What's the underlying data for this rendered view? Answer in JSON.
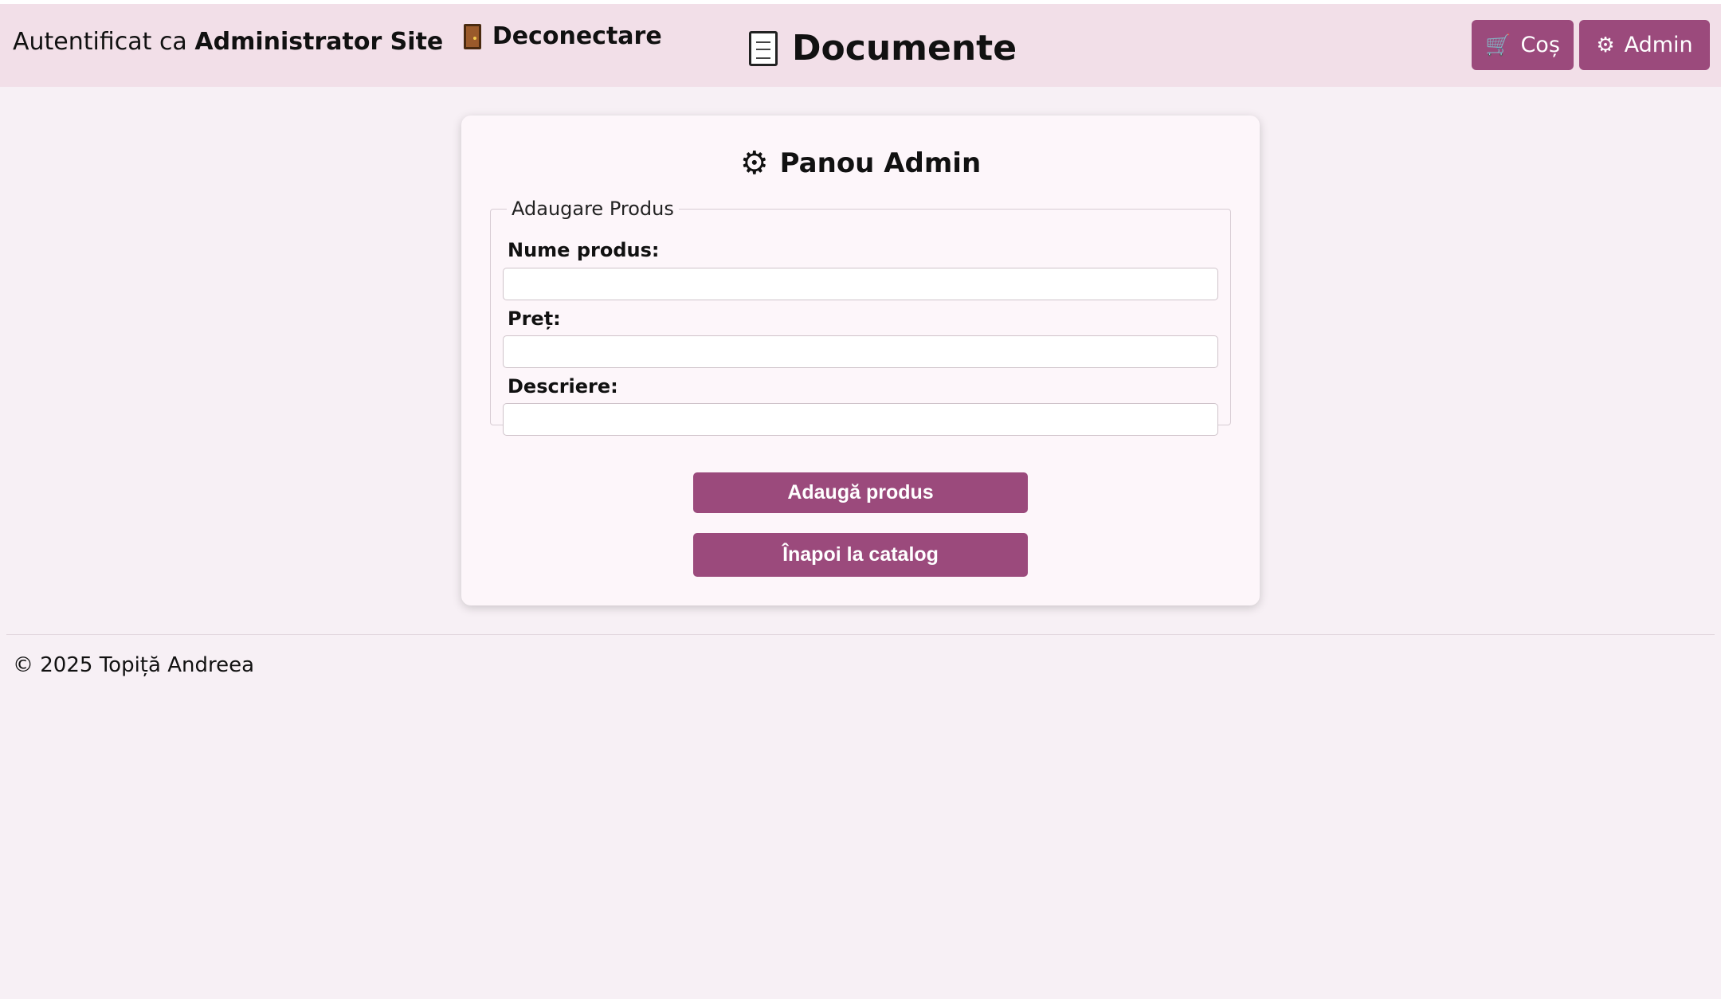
{
  "header": {
    "auth_prefix": "Autentificat ca",
    "user_name": "Administrator Site",
    "logout_label": "Deconectare",
    "site_title": "Documente",
    "nav": {
      "cart_label": "Coș",
      "admin_label": "Admin"
    }
  },
  "panel": {
    "title": "Panou Admin",
    "fieldset_legend": "Adaugare Produs",
    "fields": [
      {
        "label": "Nume produs:",
        "value": ""
      },
      {
        "label": "Preț:",
        "value": ""
      },
      {
        "label": "Descriere:",
        "value": ""
      }
    ],
    "add_button": "Adaugă produs",
    "back_button": "Înapoi la catalog"
  },
  "footer": {
    "text": "© 2025 Topiță Andreea"
  },
  "colors": {
    "accent": "#9b4a7c",
    "header_bg": "#f2dfe8",
    "page_bg": "#f7f0f5",
    "card_bg": "#fdf6fa"
  },
  "icons": {
    "logout": "door-icon",
    "title": "document-icon",
    "cart": "cart-icon",
    "admin": "gear-icon",
    "panel": "gear-icon"
  }
}
